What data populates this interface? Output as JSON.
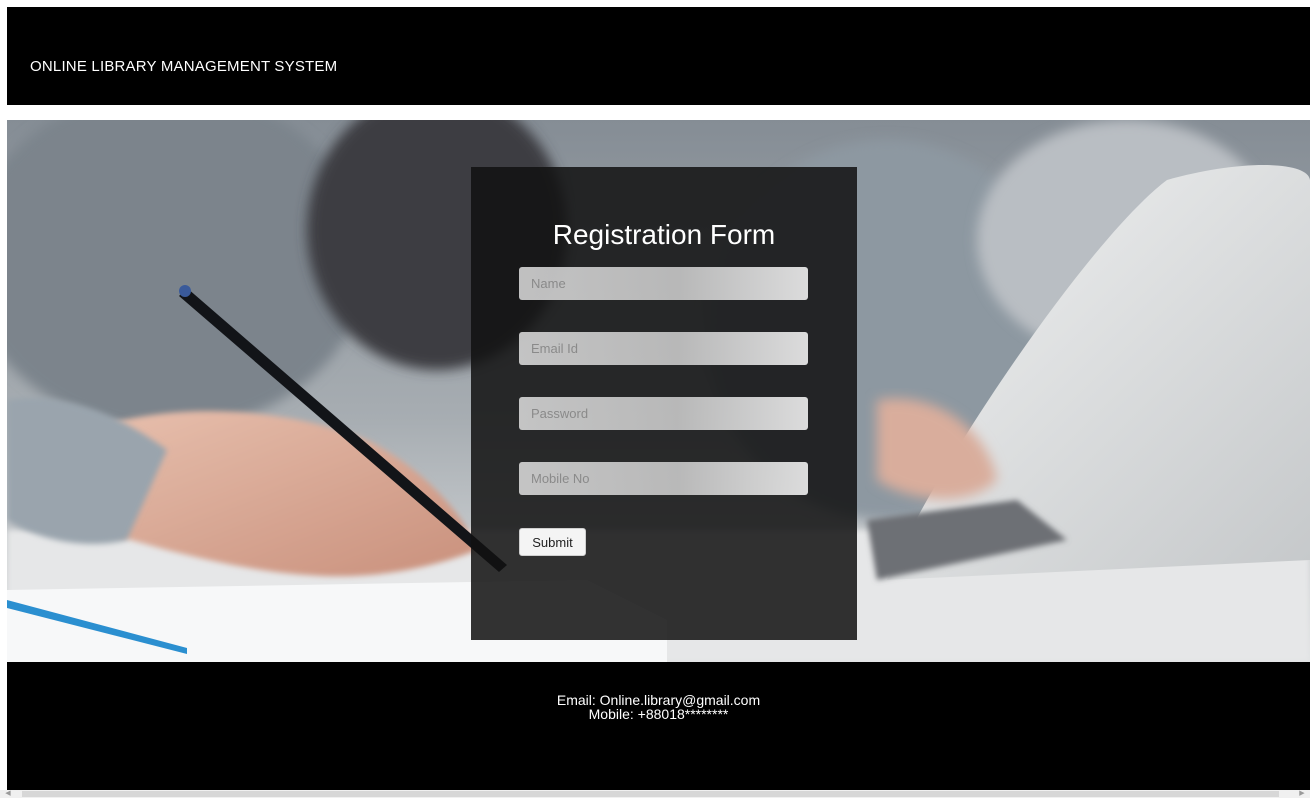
{
  "header": {
    "title": "ONLINE LIBRARY MANAGEMENT SYSTEM"
  },
  "form": {
    "title": "Registration Form",
    "name_placeholder": "Name",
    "email_placeholder": "Email Id",
    "password_placeholder": "Password",
    "mobile_placeholder": "Mobile No",
    "submit_label": "Submit"
  },
  "footer": {
    "email": "Email: Online.library@gmail.com",
    "mobile": "Mobile: +88018********"
  },
  "colors": {
    "header_bg": "#000000",
    "footer_bg": "#000000",
    "panel_bg": "#121212",
    "text_light": "#ffffff"
  },
  "scrollbar": {
    "left_arrow_icon": "arrow-left-icon",
    "right_arrow_icon": "arrow-right-icon"
  }
}
